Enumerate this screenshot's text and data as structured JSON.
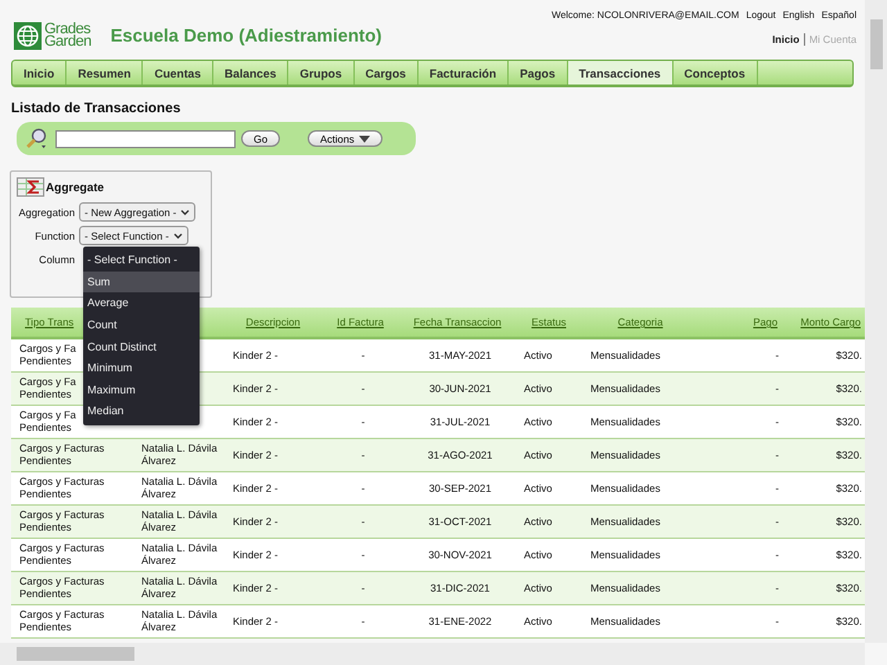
{
  "header": {
    "logo": {
      "line_1": "Grades",
      "line_2": "Garden"
    },
    "school": "Escuela Demo (Adiestramiento)",
    "welcome": "Welcome: NCOLONRIVERA@EMAIL.COM",
    "links": [
      "Logout",
      "English",
      "Español"
    ],
    "account_links": [
      {
        "label": "Inicio",
        "selected": true
      },
      {
        "label": "Mi Cuenta",
        "selected": false
      }
    ]
  },
  "nav": [
    {
      "label": "Inicio",
      "selected": false
    },
    {
      "label": "Resumen",
      "selected": false
    },
    {
      "label": "Cuentas",
      "selected": false
    },
    {
      "label": "Balances",
      "selected": false
    },
    {
      "label": "Grupos",
      "selected": false
    },
    {
      "label": "Cargos",
      "selected": false
    },
    {
      "label": "Facturación",
      "selected": false
    },
    {
      "label": "Pagos",
      "selected": false
    },
    {
      "label": "Transacciones",
      "selected": true
    },
    {
      "label": "Conceptos",
      "selected": false
    }
  ],
  "page_title": "Listado de Transacciones",
  "search": {
    "go": "Go",
    "actions": "Actions"
  },
  "aggregate": {
    "title": "Aggregate",
    "fields": [
      {
        "label": "Aggregation",
        "value": "- New Aggregation -"
      },
      {
        "label": "Function",
        "value": "- Select Function -"
      },
      {
        "label": "Column"
      }
    ],
    "function_dropdown": [
      {
        "label": "- Select Function -",
        "selected": false
      },
      {
        "label": "Sum",
        "selected": true
      },
      {
        "label": "Average",
        "selected": false
      },
      {
        "label": "Count",
        "selected": false
      },
      {
        "label": "Count Distinct",
        "selected": false
      },
      {
        "label": "Minimum",
        "selected": false
      },
      {
        "label": "Maximum",
        "selected": false
      },
      {
        "label": "Median",
        "selected": false
      }
    ]
  },
  "table": {
    "columns": [
      {
        "label": "Tipo Trans"
      },
      {},
      {
        "label": "Descripcion"
      },
      {
        "label": "Id Factura"
      },
      {
        "label": "Fecha Transaccion"
      },
      {
        "label": "Estatus"
      },
      {
        "label": "Categoria"
      },
      {
        "label": "Pago"
      },
      {
        "label": "Monto Cargo"
      }
    ],
    "rows": [
      {
        "tipo": "Cargos y Fa Pendientes",
        "descripcion": "Kinder 2 -",
        "factura": "-",
        "fecha": "31-MAY-2021",
        "estatus": "Activo",
        "categoria": "Mensualidades",
        "pago": "-",
        "monto": "$320."
      },
      {
        "tipo": "Cargos y Fa Pendientes",
        "descripcion": "Kinder 2 -",
        "factura": "-",
        "fecha": "30-JUN-2021",
        "estatus": "Activo",
        "categoria": "Mensualidades",
        "pago": "-",
        "monto": "$320."
      },
      {
        "tipo": "Cargos y Fa Pendientes",
        "descripcion": "Kinder 2 -",
        "factura": "-",
        "fecha": "31-JUL-2021",
        "estatus": "Activo",
        "categoria": "Mensualidades",
        "pago": "-",
        "monto": "$320."
      },
      {
        "tipo": "Cargos y Facturas Pendientes",
        "nombre": "Natalia L. Dávila Álvarez",
        "descripcion": "Kinder 2 -",
        "factura": "-",
        "fecha": "31-AGO-2021",
        "estatus": "Activo",
        "categoria": "Mensualidades",
        "pago": "-",
        "monto": "$320."
      },
      {
        "tipo": "Cargos y Facturas Pendientes",
        "nombre": "Natalia L. Dávila Álvarez",
        "descripcion": "Kinder 2 -",
        "factura": "-",
        "fecha": "30-SEP-2021",
        "estatus": "Activo",
        "categoria": "Mensualidades",
        "pago": "-",
        "monto": "$320."
      },
      {
        "tipo": "Cargos y Facturas Pendientes",
        "nombre": "Natalia L. Dávila Álvarez",
        "descripcion": "Kinder 2 -",
        "factura": "-",
        "fecha": "31-OCT-2021",
        "estatus": "Activo",
        "categoria": "Mensualidades",
        "pago": "-",
        "monto": "$320."
      },
      {
        "tipo": "Cargos y Facturas Pendientes",
        "nombre": "Natalia L. Dávila Álvarez",
        "descripcion": "Kinder 2 -",
        "factura": "-",
        "fecha": "30-NOV-2021",
        "estatus": "Activo",
        "categoria": "Mensualidades",
        "pago": "-",
        "monto": "$320."
      },
      {
        "tipo": "Cargos y Facturas Pendientes",
        "nombre": "Natalia L. Dávila Álvarez",
        "descripcion": "Kinder 2 -",
        "factura": "-",
        "fecha": "31-DIC-2021",
        "estatus": "Activo",
        "categoria": "Mensualidades",
        "pago": "-",
        "monto": "$320."
      },
      {
        "tipo": "Cargos y Facturas Pendientes",
        "nombre": "Natalia L. Dávila Álvarez",
        "descripcion": "Kinder 2 -",
        "factura": "-",
        "fecha": "31-ENE-2022",
        "estatus": "Activo",
        "categoria": "Mensualidades",
        "pago": "-",
        "monto": "$320."
      }
    ]
  }
}
